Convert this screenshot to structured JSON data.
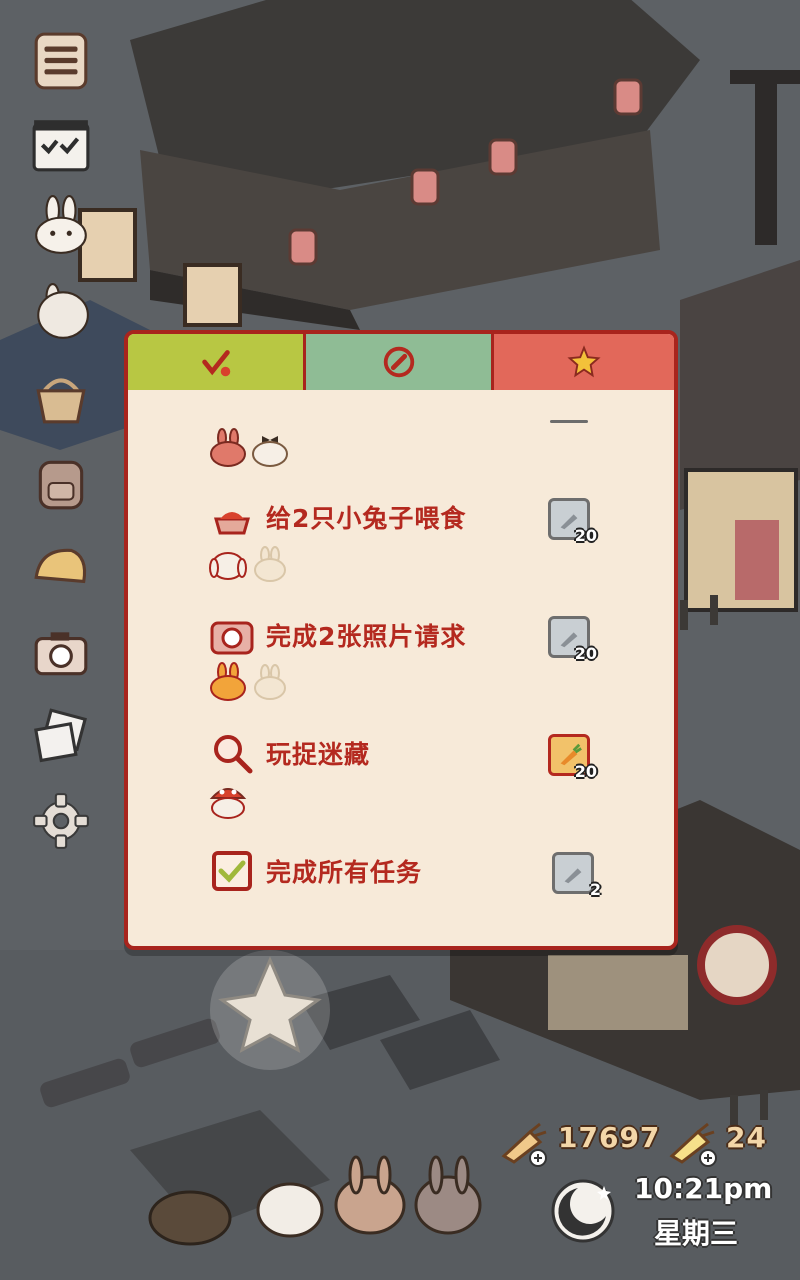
{
  "side_menu": [
    {
      "name": "menu-list-icon"
    },
    {
      "name": "task-list-icon"
    },
    {
      "name": "bunny-face-icon"
    },
    {
      "name": "bunny-sitting-icon"
    },
    {
      "name": "basket-icon"
    },
    {
      "name": "backpack-icon"
    },
    {
      "name": "bread-icon"
    },
    {
      "name": "camera-icon"
    },
    {
      "name": "photos-icon"
    },
    {
      "name": "settings-gear-icon"
    }
  ],
  "panel": {
    "tabs": [
      {
        "icon": "checkmark-icon",
        "color": "#b8c743"
      },
      {
        "icon": "carrot-coin-icon",
        "color": "#8fbc95"
      },
      {
        "icon": "star-icon",
        "color": "#e2685a"
      }
    ],
    "tasks": [
      {
        "label": "给2只小兔子喂食",
        "icon": "food-bowl-icon",
        "reward_icon": "silver-carrot-icon",
        "reward": "20"
      },
      {
        "label": "完成2张照片请求",
        "icon": "camera-icon",
        "reward_icon": "silver-carrot-icon",
        "reward": "20"
      },
      {
        "label": "玩捉迷藏",
        "icon": "magnifier-icon",
        "reward_icon": "golden-carrot-icon",
        "reward": "20"
      },
      {
        "label": "完成所有任务",
        "icon": "checkbox-icon",
        "reward_icon": "silver-carrot-icon",
        "reward": "2"
      }
    ]
  },
  "hud": {
    "carrots": "17697",
    "golden_carrots": "24",
    "time": "10:21pm",
    "weekday": "星期三"
  },
  "colors": {
    "panel_border": "#a8241d",
    "panel_bg": "#f7ead9",
    "task_text": "#b4291f"
  }
}
